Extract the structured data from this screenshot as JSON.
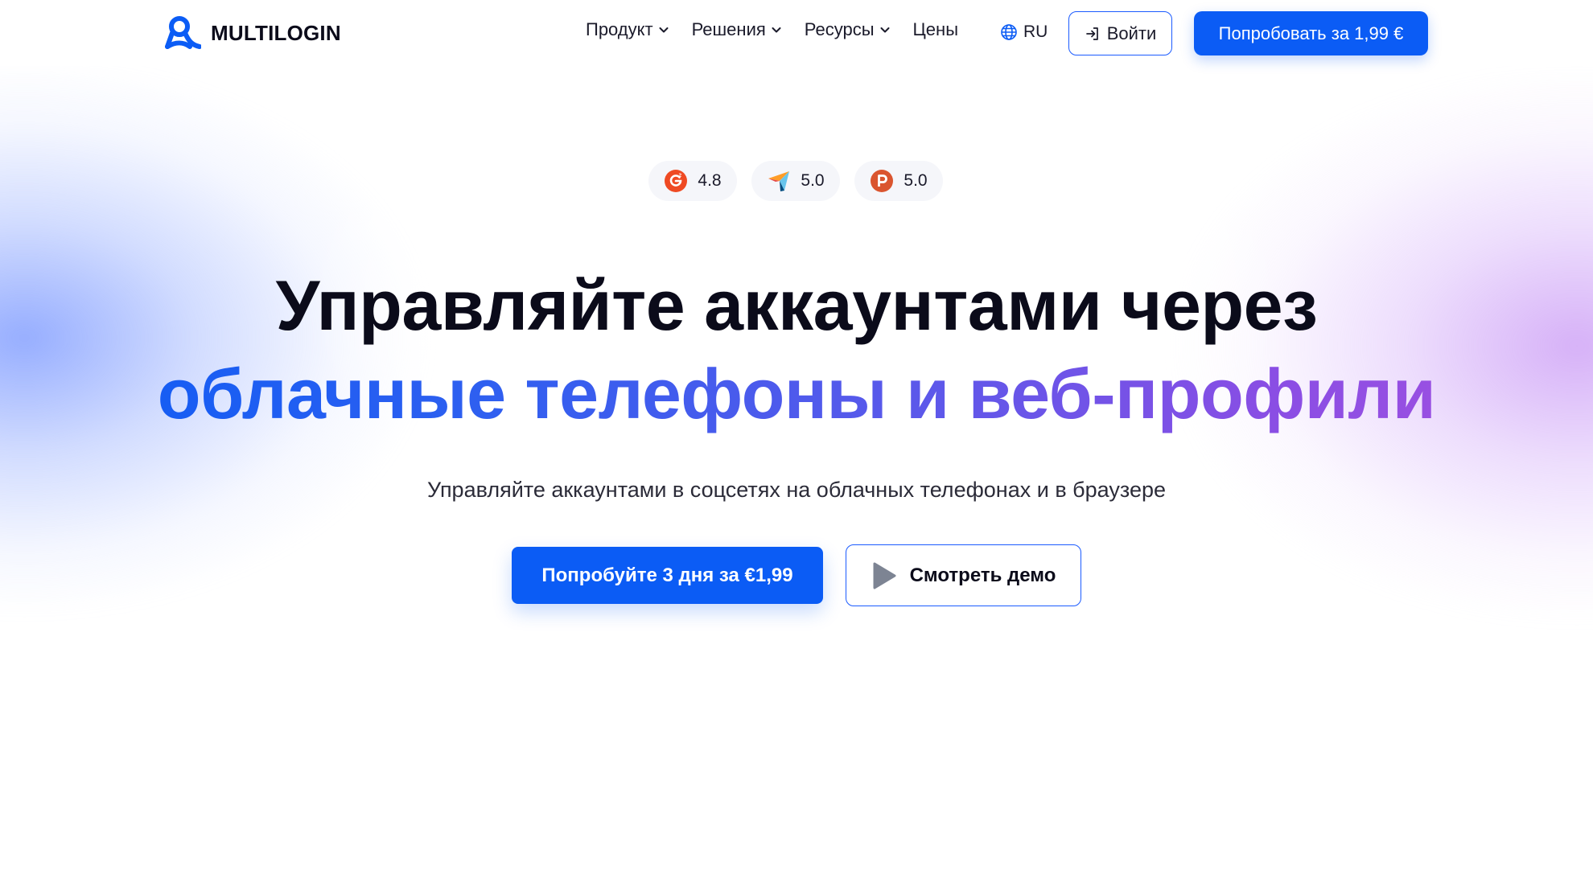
{
  "brand": {
    "name": "MULTILOGIN",
    "logo_icon": "multilogin-logo-icon",
    "accent": "#0b5cf5"
  },
  "nav": {
    "items": [
      {
        "label": "Продукт",
        "has_dropdown": true
      },
      {
        "label": "Решения",
        "has_dropdown": true
      },
      {
        "label": "Ресурсы",
        "has_dropdown": true
      },
      {
        "label": "Цены",
        "has_dropdown": false
      }
    ],
    "language": "RU",
    "login_label": "Войти",
    "try_label": "Попробовать за 1,99 €"
  },
  "ratings": [
    {
      "icon": "g2-icon",
      "value": "4.8"
    },
    {
      "icon": "capterra-icon",
      "value": "5.0"
    },
    {
      "icon": "producthunt-icon",
      "value": "5.0"
    }
  ],
  "hero": {
    "title_line1": "Управляйте аккаунтами через",
    "title_line2": "облачные телефоны и веб-профили",
    "subtitle": "Управляйте аккаунтами в соцсетях на облачных телефонах и в браузере",
    "cta_primary": "Попробуйте 3 дня за €1,99",
    "cta_secondary": "Смотреть демо"
  },
  "colors": {
    "gradient_start": "#0b5cf5",
    "gradient_end": "#a651e0",
    "g2": "#ef4a23",
    "producthunt": "#da552f"
  }
}
